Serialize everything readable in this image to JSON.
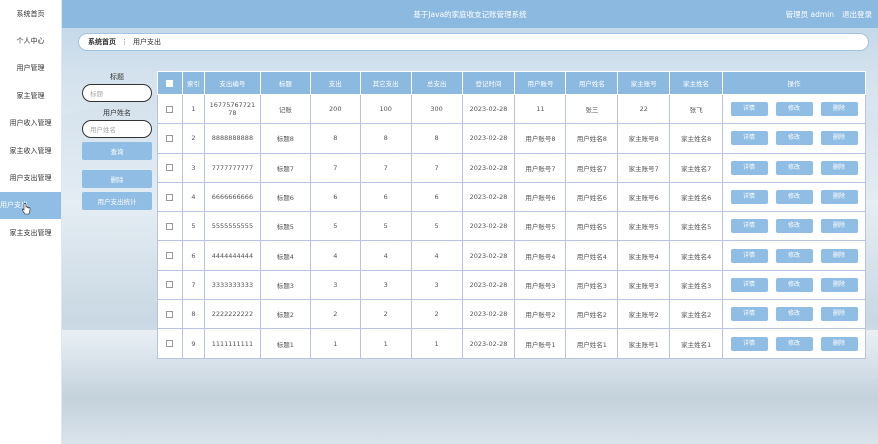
{
  "sidebar": {
    "items": [
      {
        "label": "系统首页"
      },
      {
        "label": "个人中心"
      },
      {
        "label": "用户管理"
      },
      {
        "label": "家主管理"
      },
      {
        "label": "用户收入管理"
      },
      {
        "label": "家主收入管理"
      },
      {
        "label": "用户支出管理"
      },
      {
        "label": "用户支出"
      },
      {
        "label": "家主支出管理"
      }
    ]
  },
  "header": {
    "title": "基于Java的家庭收支记账管理系统",
    "user": "管理员 admin",
    "logout": "退出登录"
  },
  "breadcrumb": {
    "home": "系统首页",
    "separator": "⋮",
    "current": "用户支出"
  },
  "filter": {
    "title_label": "标题",
    "title_placeholder": "标题",
    "name_label": "用户姓名",
    "name_placeholder": "用户姓名",
    "search_button": "查询",
    "delete_button": "删除",
    "stats_button": "用户支出统计"
  },
  "table": {
    "headers": [
      "索引",
      "支出编号",
      "标题",
      "支出",
      "其它支出",
      "总支出",
      "登记时间",
      "用户账号",
      "用户姓名",
      "家主账号",
      "家主姓名",
      "操作"
    ],
    "action_labels": [
      "详情",
      "修改",
      "删除"
    ],
    "rows": [
      [
        "1",
        "16775767721 78",
        "记账",
        "200",
        "100",
        "300",
        "2023-02-28",
        "11",
        "张三",
        "22",
        "张飞"
      ],
      [
        "2",
        "8888888888",
        "标题8",
        "8",
        "8",
        "8",
        "2023-02-28",
        "用户账号8",
        "用户姓名8",
        "家主账号8",
        "家主姓名8"
      ],
      [
        "3",
        "7777777777",
        "标题7",
        "7",
        "7",
        "7",
        "2023-02-28",
        "用户账号7",
        "用户姓名7",
        "家主账号7",
        "家主姓名7"
      ],
      [
        "4",
        "6666666666",
        "标题6",
        "6",
        "6",
        "6",
        "2023-02-28",
        "用户账号6",
        "用户姓名6",
        "家主账号6",
        "家主姓名6"
      ],
      [
        "5",
        "5555555555",
        "标题5",
        "5",
        "5",
        "5",
        "2023-02-28",
        "用户账号5",
        "用户姓名5",
        "家主账号5",
        "家主姓名5"
      ],
      [
        "6",
        "4444444444",
        "标题4",
        "4",
        "4",
        "4",
        "2023-02-28",
        "用户账号4",
        "用户姓名4",
        "家主账号4",
        "家主姓名4"
      ],
      [
        "7",
        "3333333333",
        "标题3",
        "3",
        "3",
        "3",
        "2023-02-28",
        "用户账号3",
        "用户姓名3",
        "家主账号3",
        "家主姓名3"
      ],
      [
        "8",
        "2222222222",
        "标题2",
        "2",
        "2",
        "2",
        "2023-02-28",
        "用户账号2",
        "用户姓名2",
        "家主账号2",
        "家主姓名2"
      ],
      [
        "9",
        "1111111111",
        "标题1",
        "1",
        "1",
        "1",
        "2023-02-28",
        "用户账号1",
        "用户姓名1",
        "家主账号1",
        "家主姓名1"
      ]
    ]
  }
}
